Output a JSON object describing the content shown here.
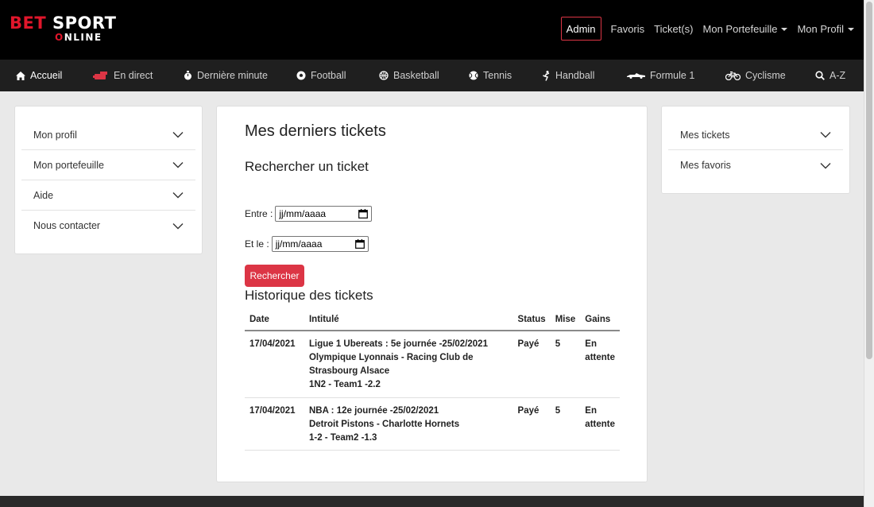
{
  "brand": {
    "bet": "BET",
    "sport": "SPORT",
    "online_prefix": "O",
    "online_rest": "NLINE"
  },
  "topnav": {
    "admin": "Admin",
    "favoris": "Favoris",
    "tickets": "Ticket(s)",
    "portefeuille": "Mon Portefeuille",
    "profil": "Mon Profil"
  },
  "sportnav": {
    "accueil": "Accueil",
    "direct": "En direct",
    "derniere": "Dernière minute",
    "football": "Football",
    "basketball": "Basketball",
    "tennis": "Tennis",
    "handball": "Handball",
    "formule1": "Formule 1",
    "cyclisme": "Cyclisme",
    "az": "A-Z"
  },
  "left_menu": [
    "Mon profil",
    "Mon portefeuille",
    "Aide",
    "Nous contacter"
  ],
  "right_menu": [
    "Mes tickets",
    "Mes favoris"
  ],
  "main": {
    "title": "Mes derniers tickets",
    "search_title": "Rechercher un ticket",
    "from_label": "Entre :",
    "to_label": "Et le :",
    "date_placeholder": "jj/mm/aaaa",
    "search_button": "Rechercher",
    "history_title": "Historique des tickets",
    "columns": [
      "Date",
      "Intitulé",
      "Status",
      "Mise",
      "Gains"
    ],
    "rows": [
      {
        "date": "17/04/2021",
        "line1": "Ligue 1 Ubereats : 5e journée -25/02/2021",
        "line2": "Olympique Lyonnais - Racing Club de",
        "line3": "Strasbourg Alsace",
        "line4": "1N2 - Team1 -2.2",
        "status": "Payé",
        "mise": "5",
        "gains1": "En",
        "gains2": "attente"
      },
      {
        "date": "17/04/2021",
        "line1": "NBA : 12e journée -25/02/2021",
        "line2": "Detroit Pistons - Charlotte Hornets",
        "line3": "1-2 - Team2 -1.3",
        "line4": "",
        "status": "Payé",
        "mise": "5",
        "gains1": "En",
        "gains2": "attente"
      }
    ]
  },
  "colors": {
    "accent_red": "#dc3545",
    "status_cyan": "#17a2b8",
    "header_bg": "#000000",
    "nav_bg": "#1f1f1f"
  }
}
